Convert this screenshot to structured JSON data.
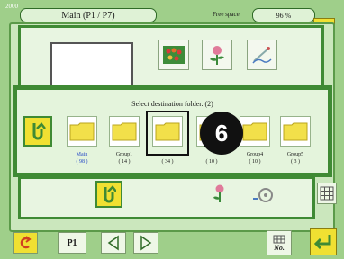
{
  "header": {
    "corner_label": "2000",
    "title": "Main (P1 / P7)",
    "free_space_label": "Free space",
    "free_space_value": "96 %"
  },
  "dialog": {
    "title": "Select destination folder. (2)",
    "folders": [
      {
        "name": "Main",
        "count": "( 98 )",
        "selected": false
      },
      {
        "name": "Group1",
        "count": "( 14 )",
        "selected": false
      },
      {
        "name": "",
        "count": "( 34 )",
        "selected": true
      },
      {
        "name": "",
        "count": "( 10 )",
        "selected": false
      },
      {
        "name": "Group4",
        "count": "( 10 )",
        "selected": false
      },
      {
        "name": "Group5",
        "count": "( 3 )",
        "selected": false
      }
    ],
    "callout_number": "6"
  },
  "bottom_bar": {
    "p1_label": "P1",
    "no_label": "No."
  },
  "colors": {
    "background": "#9fcf8a",
    "panel_border": "#3f8a34",
    "folder_yellow": "#f2e04a",
    "return_button": "#f0e032",
    "main_label": "#2549c6"
  },
  "icons": [
    "return-arrow-icon",
    "folder-icon",
    "embroidery-pattern-icon",
    "rose-icon",
    "sewing-icon",
    "grid-icon",
    "prev-arrow-icon",
    "next-arrow-icon",
    "ok-arrow-icon",
    "undo-icon"
  ]
}
